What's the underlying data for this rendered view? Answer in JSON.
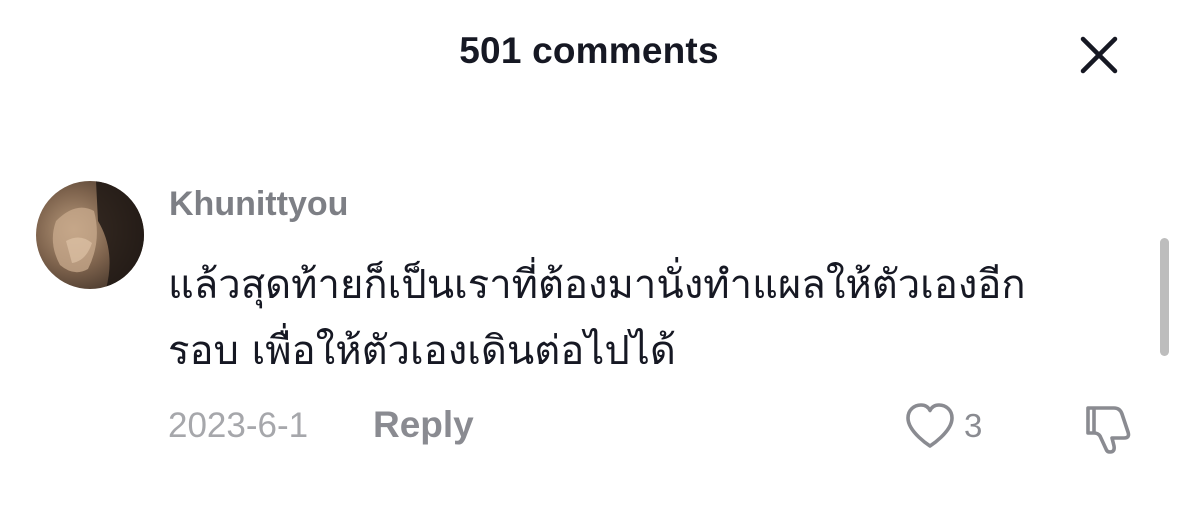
{
  "header": {
    "title": "501 comments",
    "close_icon": "close-icon"
  },
  "comment": {
    "username": "Khunittyou",
    "text_line1": "แล้วสุดท้ายก็เป็นเราที่ต้องมานั่งทำแผลให้ตัวเองอีก",
    "text_line2": "รอบ เพื่อให้ตัวเองเดินต่อไปได้",
    "date": "2023-6-1",
    "reply_label": "Reply",
    "like_count": "3",
    "like_icon": "heart-outline-icon",
    "dislike_icon": "thumbs-down-icon",
    "avatar": "user-avatar"
  },
  "colors": {
    "text_primary": "#161823",
    "text_secondary": "#8a8b91",
    "username": "#7d7f85",
    "scrollbar": "#bdbdbd"
  }
}
